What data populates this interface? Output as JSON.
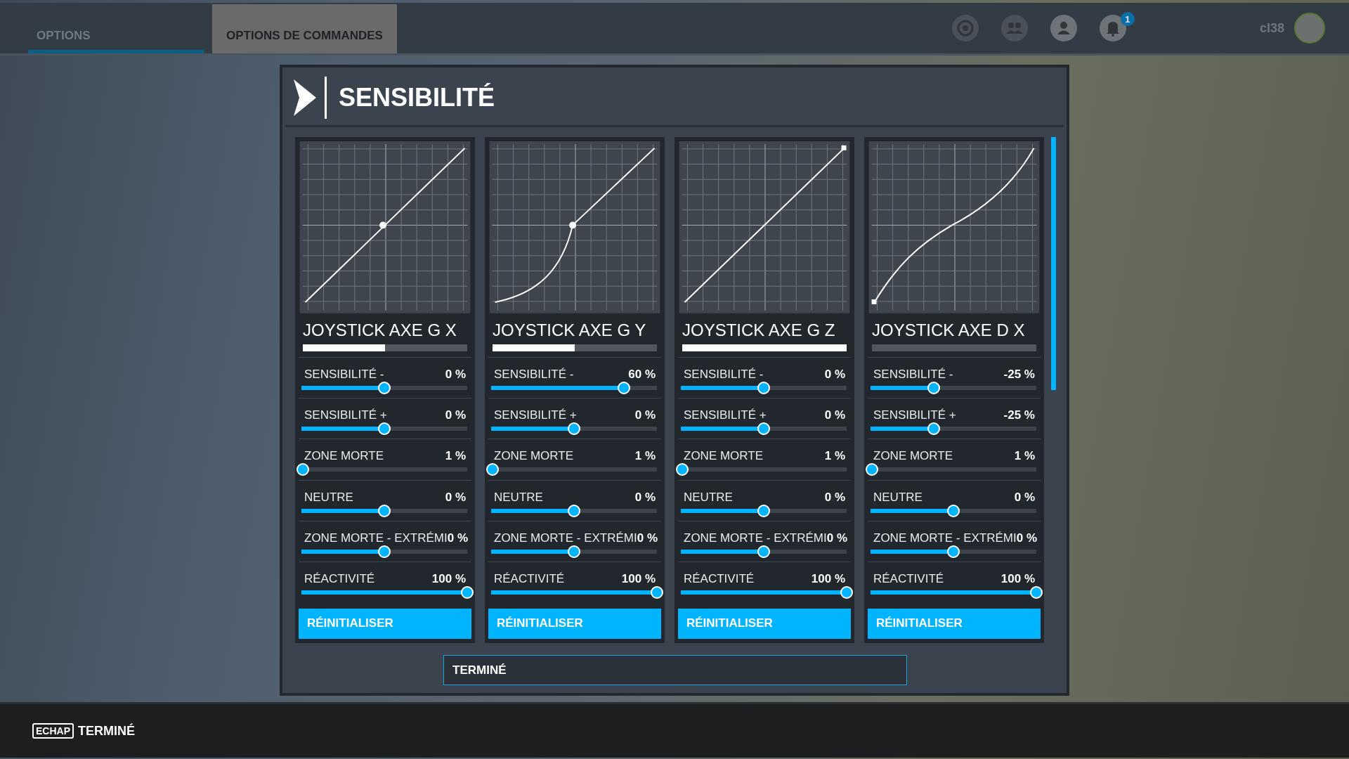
{
  "top_bar": {
    "tabs": [
      {
        "label": "OPTIONS",
        "selected": true,
        "kind": "tab"
      },
      {
        "label": "OPTIONS DE COMMANDES",
        "selected": false,
        "kind": "page"
      }
    ],
    "notification_count": "1",
    "username": "cl38"
  },
  "dialog": {
    "title": "SENSIBILITÉ",
    "cards": [
      {
        "title": "JOYSTICK AXE G X",
        "kind": "linear-mid",
        "input": {
          "level": 0.5
        },
        "settings": [
          {
            "label": "SENSIBILITÉ -",
            "value": "0 %",
            "level": 0.5
          },
          {
            "label": "SENSIBILITÉ +",
            "value": "0 %",
            "level": 0.5
          },
          {
            "label": "ZONE MORTE",
            "value": "1 %",
            "level": 0.01
          },
          {
            "label": "NEUTRE",
            "value": "0 %",
            "level": 0.5
          },
          {
            "label": "ZONE MORTE - EXTRÉMI",
            "value": "0 %",
            "level": 0.5
          },
          {
            "label": "RÉACTIVITÉ",
            "value": "100 %",
            "level": 1
          }
        ],
        "reset": "RÉINITIALISER"
      },
      {
        "title": "JOYSTICK AXE G Y",
        "kind": "concave-mid",
        "input": {
          "level": 0.5
        },
        "settings": [
          {
            "label": "SENSIBILITÉ -",
            "value": "60 %",
            "level": 0.8
          },
          {
            "label": "SENSIBILITÉ +",
            "value": "0 %",
            "level": 0.5
          },
          {
            "label": "ZONE MORTE",
            "value": "1 %",
            "level": 0.01
          },
          {
            "label": "NEUTRE",
            "value": "0 %",
            "level": 0.5
          },
          {
            "label": "ZONE MORTE - EXTRÉMI",
            "value": "0 %",
            "level": 0.5
          },
          {
            "label": "RÉACTIVITÉ",
            "value": "100 %",
            "level": 1
          }
        ],
        "reset": "RÉINITIALISER"
      },
      {
        "title": "JOYSTICK AXE G Z",
        "kind": "linear-top",
        "input": {
          "level": 1
        },
        "settings": [
          {
            "label": "SENSIBILITÉ -",
            "value": "0 %",
            "level": 0.5
          },
          {
            "label": "SENSIBILITÉ +",
            "value": "0 %",
            "level": 0.5
          },
          {
            "label": "ZONE MORTE",
            "value": "1 %",
            "level": 0.01
          },
          {
            "label": "NEUTRE",
            "value": "0 %",
            "level": 0.5
          },
          {
            "label": "ZONE MORTE - EXTRÉMI",
            "value": "0 %",
            "level": 0.5
          },
          {
            "label": "RÉACTIVITÉ",
            "value": "100 %",
            "level": 1
          }
        ],
        "reset": "RÉINITIALISER"
      },
      {
        "title": "JOYSTICK AXE D X",
        "kind": "s-bottom",
        "input": {
          "level": 0
        },
        "settings": [
          {
            "label": "SENSIBILITÉ -",
            "value": "-25 %",
            "level": 0.38
          },
          {
            "label": "SENSIBILITÉ +",
            "value": "-25 %",
            "level": 0.38
          },
          {
            "label": "ZONE MORTE",
            "value": "1 %",
            "level": 0.01
          },
          {
            "label": "NEUTRE",
            "value": "0 %",
            "level": 0.5
          },
          {
            "label": "ZONE MORTE - EXTRÉMI",
            "value": "0 %",
            "level": 0.5
          },
          {
            "label": "RÉACTIVITÉ",
            "value": "100 %",
            "level": 1
          }
        ],
        "reset": "RÉINITIALISER"
      }
    ],
    "done_button": "TERMINÉ"
  },
  "bottom_bar": {
    "key": "ECHAP",
    "action": "TERMINÉ"
  }
}
